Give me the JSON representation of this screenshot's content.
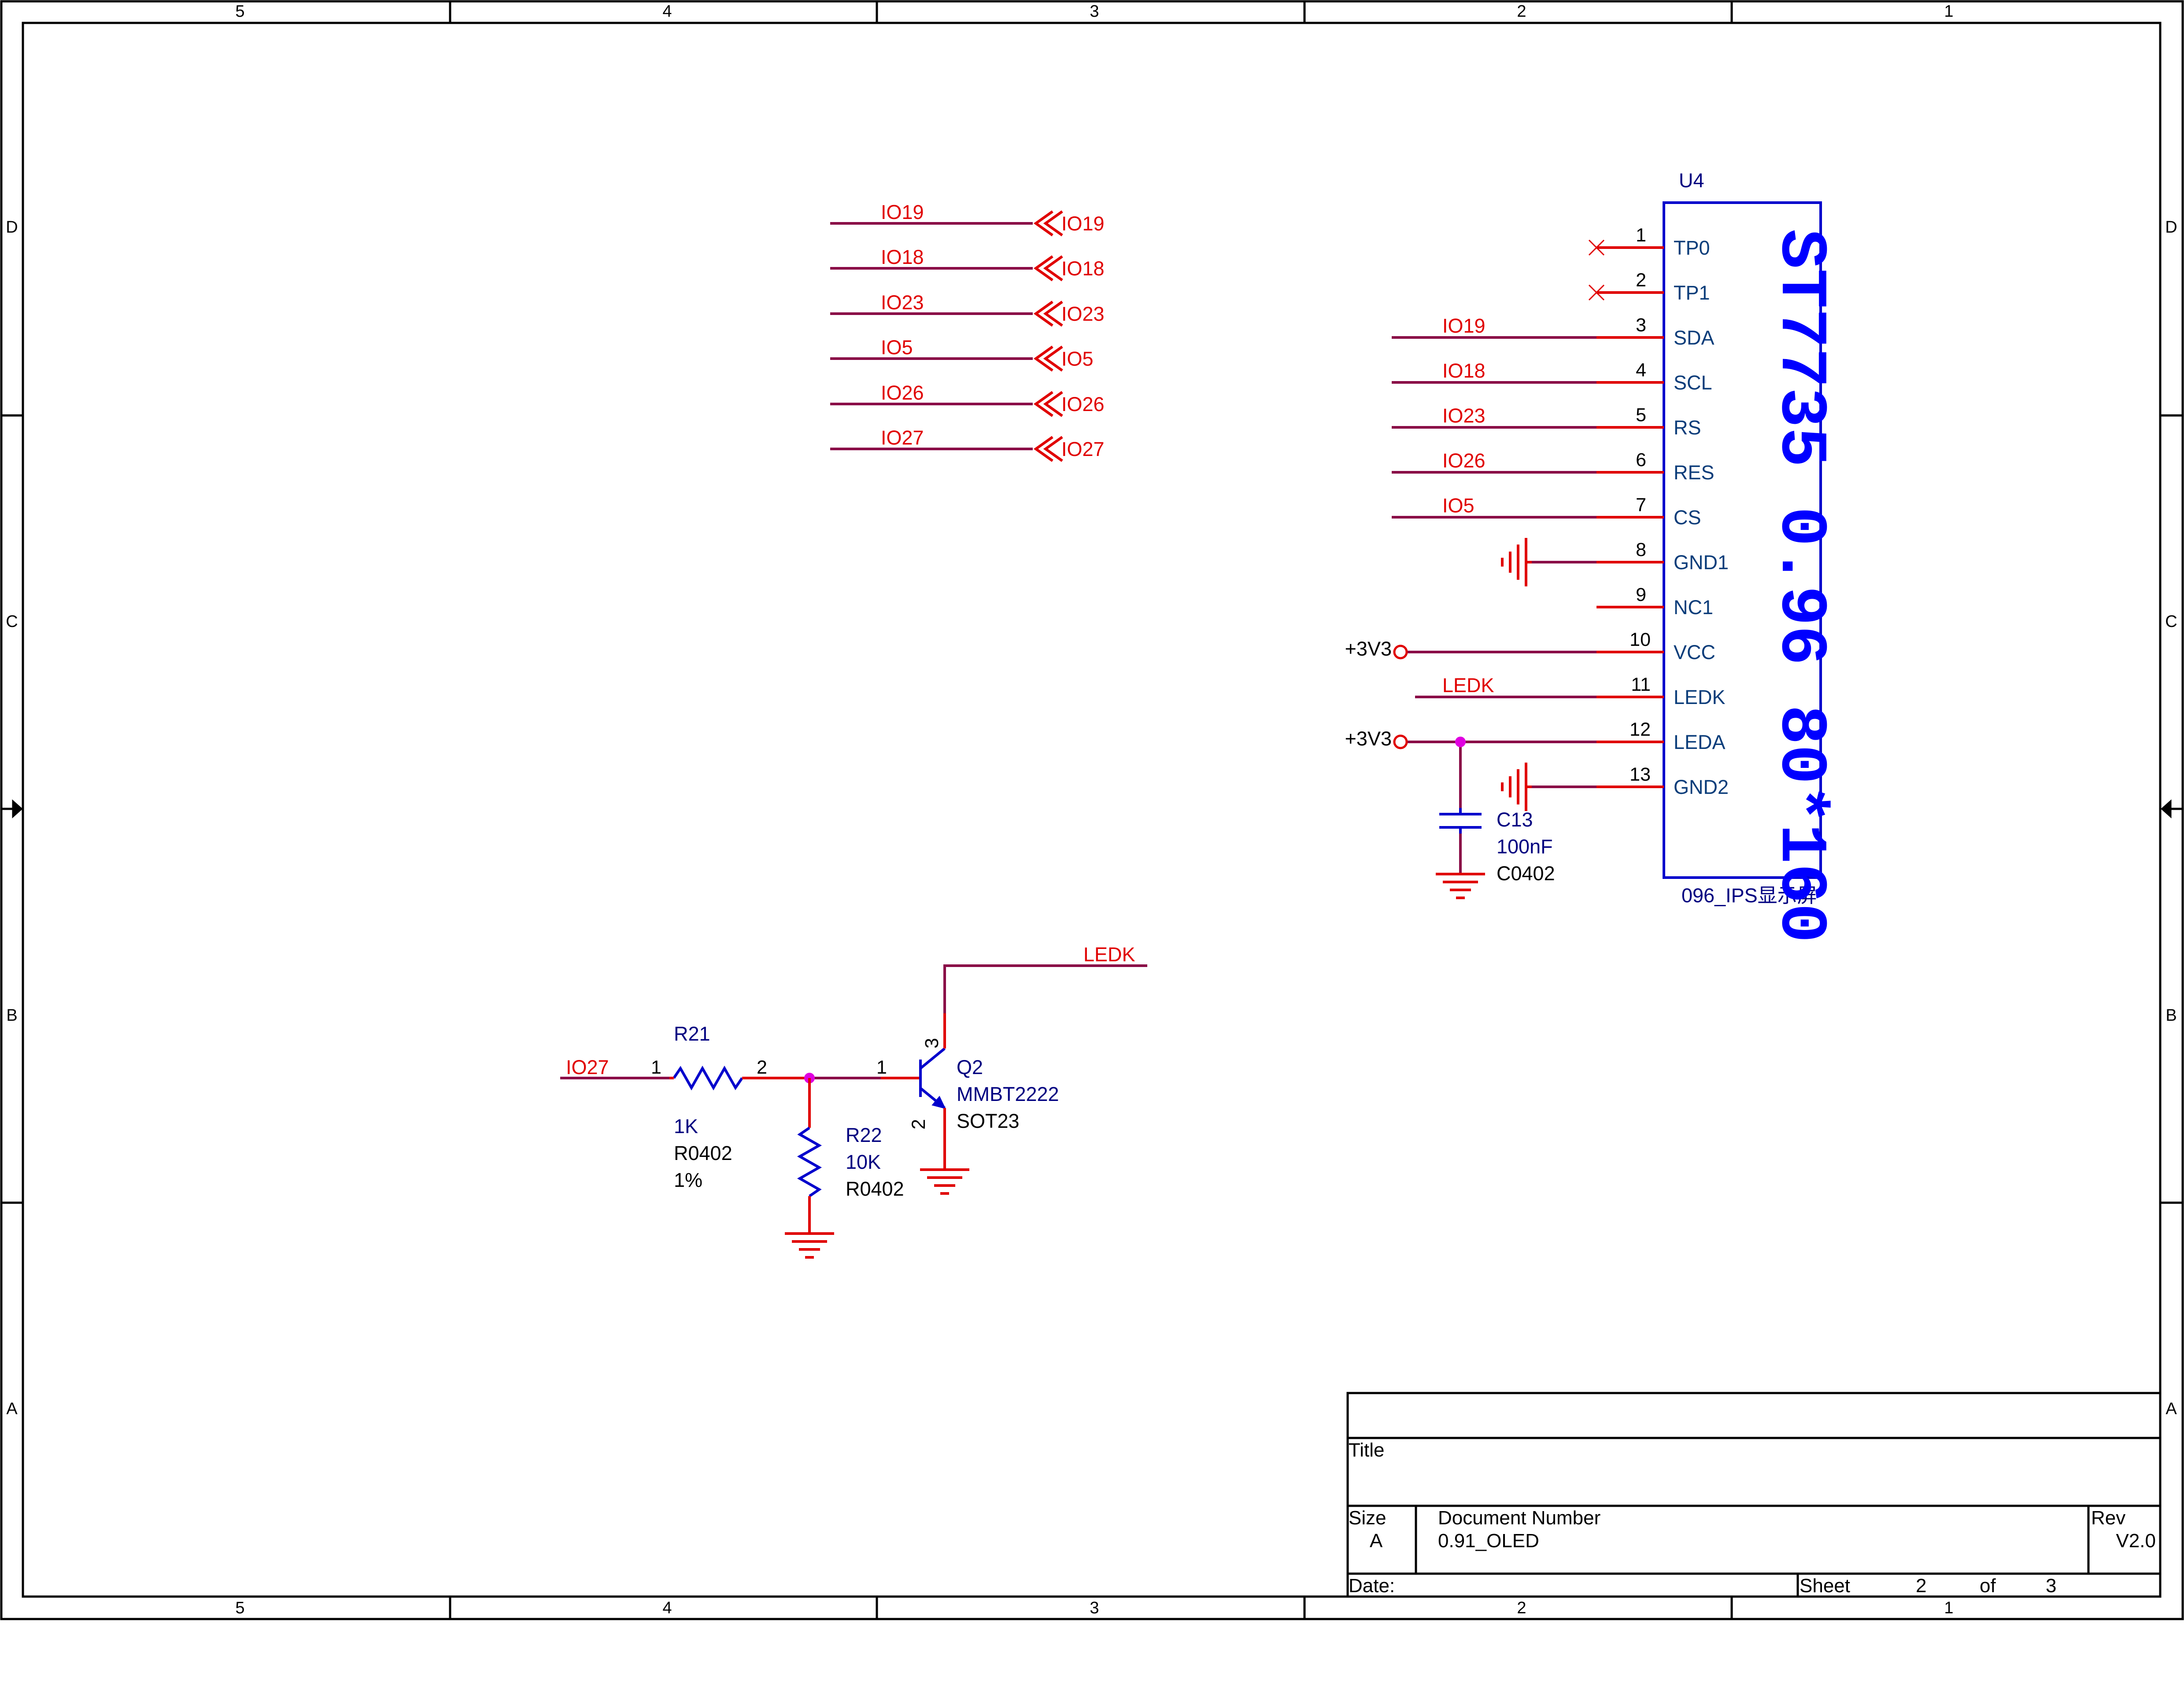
{
  "frame": {
    "column_markers": [
      "5",
      "4",
      "3",
      "2",
      "1"
    ],
    "row_markers": [
      "D",
      "C",
      "B",
      "A"
    ]
  },
  "net_ports": [
    {
      "wire_label": "IO19",
      "port_label": "IO19"
    },
    {
      "wire_label": "IO18",
      "port_label": "IO18"
    },
    {
      "wire_label": "IO23",
      "port_label": "IO23"
    },
    {
      "wire_label": "IO5",
      "port_label": "IO5"
    },
    {
      "wire_label": "IO26",
      "port_label": "IO26"
    },
    {
      "wire_label": "IO27",
      "port_label": "IO27"
    }
  ],
  "u4": {
    "refdes": "U4",
    "part_text": "ST7735 0.96 80*160",
    "footprint": "096_IPS显示屏",
    "pins": [
      {
        "number": "1",
        "name": "TP0",
        "net": ""
      },
      {
        "number": "2",
        "name": "TP1",
        "net": ""
      },
      {
        "number": "3",
        "name": "SDA",
        "net": "IO19"
      },
      {
        "number": "4",
        "name": "SCL",
        "net": "IO18"
      },
      {
        "number": "5",
        "name": "RS",
        "net": "IO23"
      },
      {
        "number": "6",
        "name": "RES",
        "net": "IO26"
      },
      {
        "number": "7",
        "name": "CS",
        "net": "IO5"
      },
      {
        "number": "8",
        "name": "GND1",
        "net": ""
      },
      {
        "number": "9",
        "name": "NC1",
        "net": ""
      },
      {
        "number": "10",
        "name": "VCC",
        "net": ""
      },
      {
        "number": "11",
        "name": "LEDK",
        "net": "LEDK"
      },
      {
        "number": "12",
        "name": "LEDA",
        "net": ""
      },
      {
        "number": "13",
        "name": "GND2",
        "net": ""
      }
    ]
  },
  "power": {
    "vcc_label": "+3V3",
    "leda_label": "+3V3"
  },
  "c13": {
    "refdes": "C13",
    "value": "100nF",
    "footprint": "C0402"
  },
  "r21": {
    "refdes": "R21",
    "value": "1K",
    "footprint": "R0402",
    "tolerance": "1%",
    "pin1": "1",
    "pin2": "2",
    "input_net": "IO27"
  },
  "r22": {
    "refdes": "R22",
    "value": "10K",
    "footprint": "R0402"
  },
  "q2": {
    "refdes": "Q2",
    "value": "MMBT2222",
    "footprint": "SOT23",
    "pin_base": "1",
    "pin_emitter": "2",
    "pin_collector": "3",
    "collector_net": "LEDK"
  },
  "title_block": {
    "title_label": "Title",
    "title_value": "",
    "size_label": "Size",
    "size_value": "A",
    "docnum_label": "Document Number",
    "docnum_value": "0.91_OLED",
    "rev_label": "Rev",
    "rev_value": "V2.0",
    "date_label": "Date:",
    "sheet_label": "Sheet",
    "sheet_num": "2",
    "of_label": "of",
    "sheet_total": "3"
  }
}
